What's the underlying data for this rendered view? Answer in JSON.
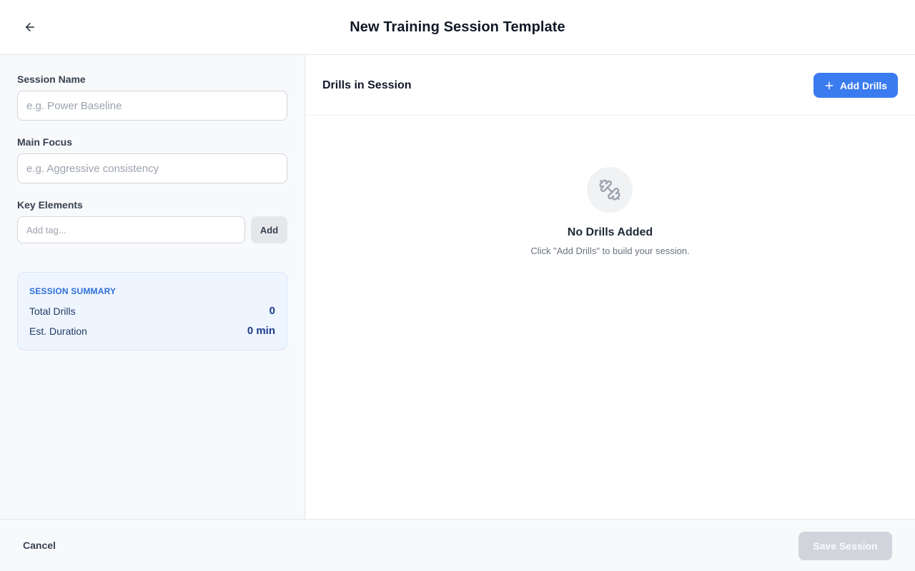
{
  "header": {
    "title": "New Training Session Template",
    "back_icon": "arrow-left-icon"
  },
  "form": {
    "session_name": {
      "label": "Session Name",
      "value": "",
      "placeholder": "e.g. Power Baseline"
    },
    "main_focus": {
      "label": "Main Focus",
      "value": "",
      "placeholder": "e.g. Aggressive consistency"
    },
    "key_elements": {
      "label": "Key Elements",
      "value": "",
      "placeholder": "Add tag...",
      "add_label": "Add"
    }
  },
  "summary": {
    "title": "SESSION SUMMARY",
    "total_drills_label": "Total Drills",
    "total_drills_value": "0",
    "duration_label": "Est. Duration",
    "duration_value": "0 min"
  },
  "drills": {
    "title": "Drills in Session",
    "add_label": "Add Drills",
    "add_icon": "plus-icon",
    "empty_icon": "dumbbell-icon",
    "empty_title": "No Drills Added",
    "empty_subtitle": "Click \"Add Drills\" to build your session."
  },
  "footer": {
    "cancel_label": "Cancel",
    "save_label": "Save Session"
  },
  "colors": {
    "primary": "#3b7bf0",
    "summary_bg": "#eef5ff",
    "summary_accent": "#2f6fd8",
    "disabled": "#d1d5db"
  }
}
